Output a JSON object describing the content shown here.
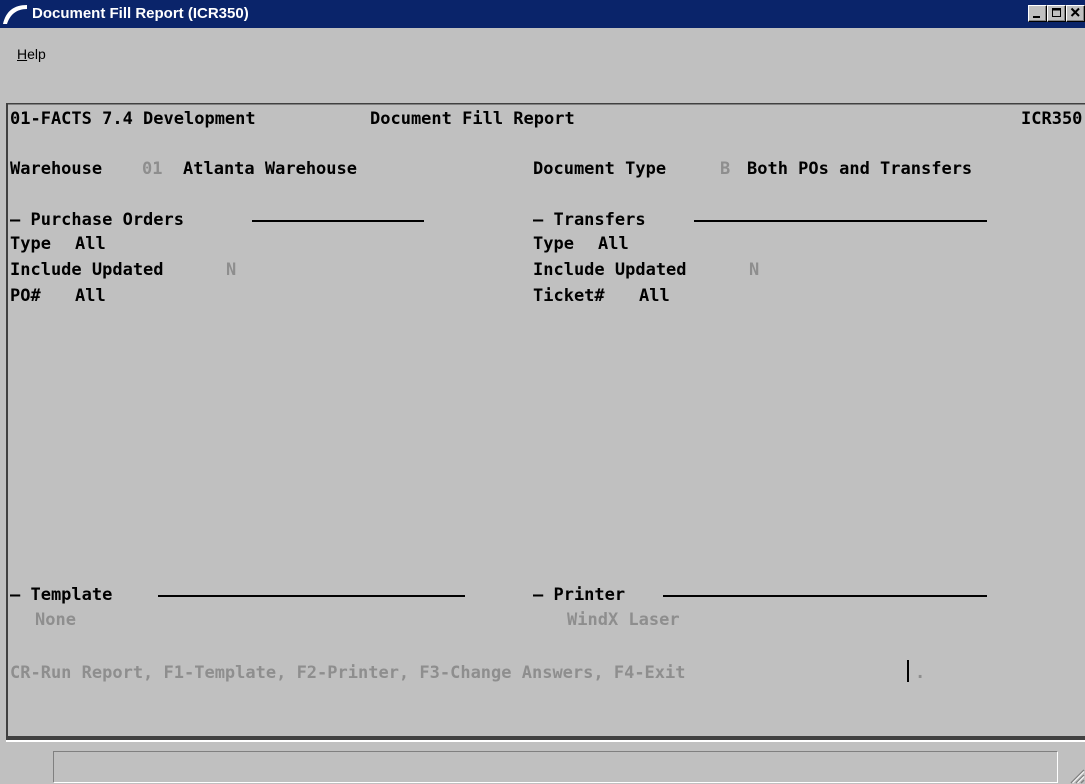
{
  "window": {
    "title": "Document Fill Report (ICR350)",
    "controls": {
      "minimize": "_",
      "maximize": "□",
      "close": "×"
    }
  },
  "menu": {
    "help_first": "H",
    "help_rest": "elp"
  },
  "header": {
    "company": "01-FACTS 7.4 Development",
    "report_title": "Document Fill Report",
    "program_id": "ICR350"
  },
  "warehouse": {
    "label": "Warehouse",
    "code": "01",
    "name": "Atlanta Warehouse"
  },
  "document_type": {
    "label": "Document Type",
    "code": "B",
    "description": "Both POs and Transfers"
  },
  "purchase_orders": {
    "heading": "– Purchase Orders",
    "type_label": "Type",
    "type_value": "All",
    "include_label": "Include Updated",
    "include_value": "N",
    "number_label": "PO#",
    "number_value": "All"
  },
  "transfers": {
    "heading": "– Transfers",
    "type_label": "Type",
    "type_value": "All",
    "include_label": "Include Updated",
    "include_value": "N",
    "number_label": "Ticket#",
    "number_value": "All"
  },
  "template": {
    "heading": "– Template",
    "value": "None"
  },
  "printer": {
    "heading": "– Printer",
    "value": "WindX Laser"
  },
  "prompt": {
    "text": "CR-Run Report, F1-Template, F2-Printer, F3-Change Answers, F4-Exit",
    "input_value": "."
  },
  "colors": {
    "titlebar": "#0a246a",
    "background": "#c0c0c0",
    "dim_text": "#8e8e8e"
  }
}
